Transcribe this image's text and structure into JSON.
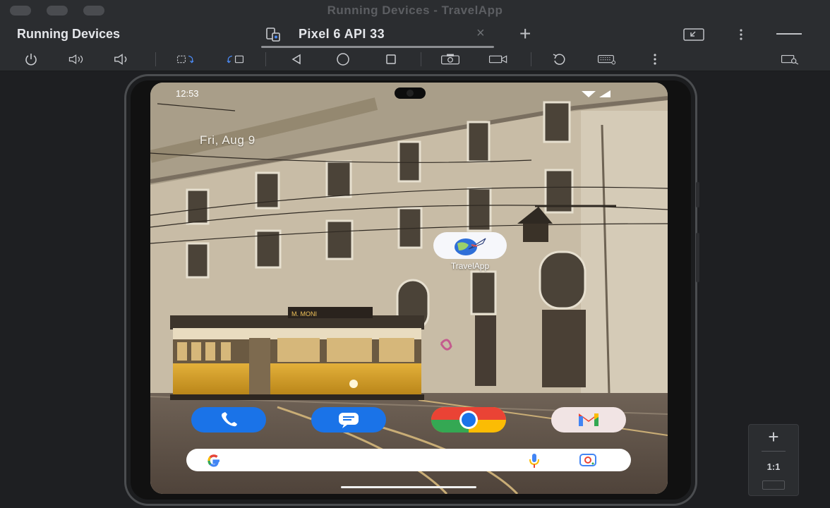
{
  "window": {
    "title": "Running Devices - TravelApp"
  },
  "panel": {
    "title": "Running Devices"
  },
  "tabs": [
    {
      "label": "Pixel 6 API 33"
    }
  ],
  "toolbar": {
    "icons": [
      "power-icon",
      "volume-up-icon",
      "volume-down-icon",
      "rotate-left-icon",
      "rotate-right-icon",
      "back-icon",
      "home-icon",
      "overview-icon",
      "screenshot-icon",
      "screen-record-icon",
      "snapshot-icon",
      "keyboard-icon",
      "more-icon",
      "layout-inspector-icon"
    ]
  },
  "phone": {
    "status": {
      "time": "12:53"
    },
    "date": "Fri, Aug 9",
    "app": {
      "label": "TravelApp"
    },
    "tram_sign": "M. MONI",
    "dock": [
      "Phone",
      "Messages",
      "Chrome",
      "Gmail"
    ]
  },
  "zoom": {
    "actual_size_label": "1:1"
  },
  "colors": {
    "chrome_bg": "#2b2d30",
    "editor_bg": "#1e1f22",
    "phone_blue": "#1a73e8",
    "gmail_red": "#ea4335"
  }
}
